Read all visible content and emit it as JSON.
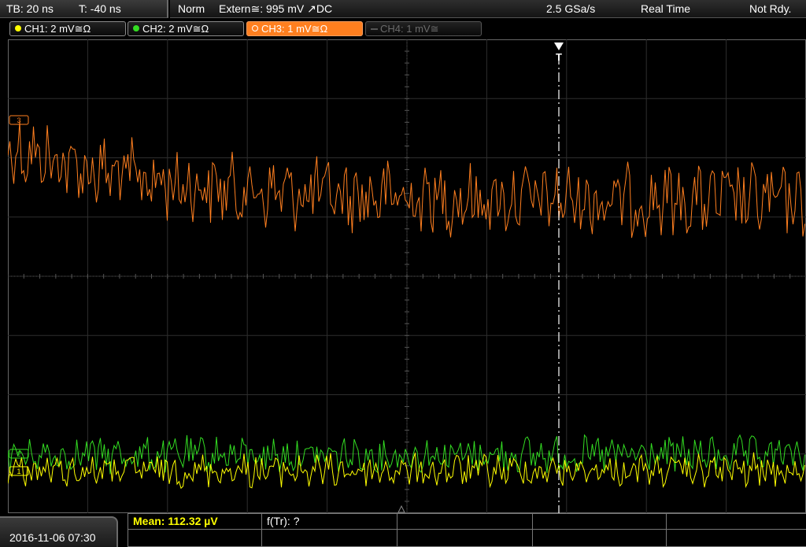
{
  "status_bar": {
    "timebase": "TB: 20 ns",
    "trigger_time": "T: -40 ns",
    "trigger_mode": "Norm",
    "trigger_source": "Extern≅: 995 mV ↗DC",
    "sample_rate": "2.5 GSa/s",
    "acq_mode": "Real Time",
    "status": "Not Rdy."
  },
  "channels": [
    {
      "label": "CH1: 2 mV≅Ω",
      "color": "#ffff00",
      "state": "on"
    },
    {
      "label": "CH2: 2 mV≅Ω",
      "color": "#33dd22",
      "state": "on"
    },
    {
      "label": "CH3: 1 mV≅Ω",
      "color": "#ff7f1f",
      "state": "selected"
    },
    {
      "label": "CH4: 1 mV≅",
      "color": "#555555",
      "state": "off"
    }
  ],
  "markers": {
    "ch1_marker": "1",
    "ch2_marker": "2",
    "ch3_marker": "3",
    "trigger_marker": "T"
  },
  "bottom": {
    "datetime": "2016-11-06 07:30",
    "measurement_mean": "Mean: 112.32 µV",
    "measurement_ftr": "f(Tr): ?"
  },
  "colors": {
    "grid": "#2e2e2e",
    "trigger_line": "#ffffff",
    "ch3_trace": "#ff7f1f",
    "ch2_trace": "#33dd22",
    "ch1_trace": "#ffff00",
    "mean_text": "#ffff00"
  }
}
